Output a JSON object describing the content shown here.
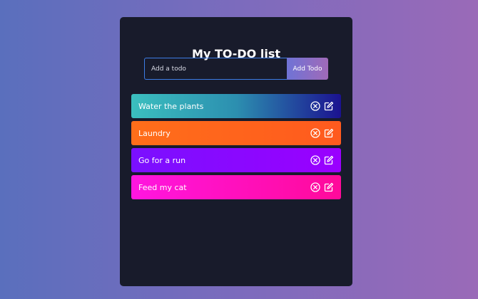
{
  "app": {
    "title": "My TO-DO list"
  },
  "form": {
    "input_value": "",
    "placeholder": "Add a todo",
    "add_button_label": "Add Todo"
  },
  "todos": [
    {
      "text": "Water the plants",
      "delete_icon": "circle-x-icon",
      "edit_icon": "edit-icon"
    },
    {
      "text": "Laundry",
      "delete_icon": "circle-x-icon",
      "edit_icon": "edit-icon"
    },
    {
      "text": "Go for a run",
      "delete_icon": "circle-x-icon",
      "edit_icon": "edit-icon"
    },
    {
      "text": "Feed my cat",
      "delete_icon": "circle-x-icon",
      "edit_icon": "edit-icon"
    }
  ],
  "colors": {
    "background_start": "#5a6fbd",
    "background_end": "#9a6ab8",
    "panel": "#181b2b",
    "input_border": "#3d7de6",
    "button_gradient_start": "#6f73d6",
    "button_gradient_end": "#a06ab8",
    "item_1_start": "#3bbfbf",
    "item_1_end": "#1b1290",
    "item_2": "#ff6e1a",
    "item_3": "#7a10ff",
    "item_4": "#ff16e0"
  }
}
